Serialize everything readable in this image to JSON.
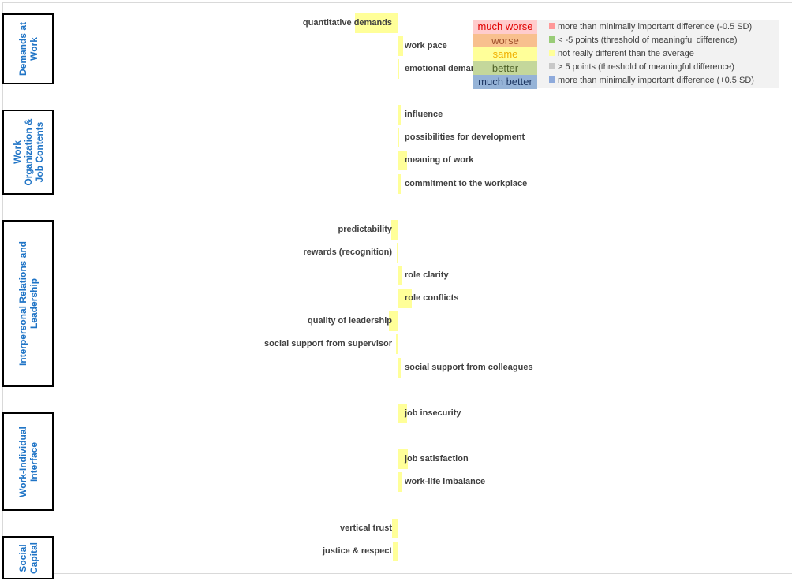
{
  "chart_data": {
    "type": "bar",
    "orientation": "horizontal-diverging",
    "groups": [
      {
        "name": "Demands at\nWork",
        "items": [
          "quantitative demands",
          "work pace",
          "emotional demands"
        ]
      },
      {
        "name": "Work\nOrganization &\nJob Contents",
        "items": [
          "influence",
          "possibilities for development",
          "meaning of work",
          "commitment to the workplace"
        ]
      },
      {
        "name": "Interpersonal Relations and\nLeadership",
        "items": [
          "predictability",
          "rewards (recognition)",
          "role clarity",
          "role conflicts",
          "quality of leadership",
          "social support from supervisor",
          "social support from colleagues"
        ]
      },
      {
        "name": "Work-Individual\nInterface",
        "items": [
          "job insecurity",
          "job satisfaction",
          "work-life imbalance"
        ]
      },
      {
        "name": "Social\nCapital",
        "items": [
          "vertical trust",
          "justice & respect"
        ]
      }
    ],
    "categories": [
      "quantitative demands",
      "work pace",
      "emotional demands",
      "influence",
      "possibilities for development",
      "meaning of work",
      "commitment to the workplace",
      "predictability",
      "rewards (recognition)",
      "role clarity",
      "role conflicts",
      "quality of leadership",
      "social support from supervisor",
      "social support from colleagues",
      "job insecurity",
      "job satisfaction",
      "work-life imbalance",
      "vertical trust",
      "justice & respect"
    ],
    "values": [
      -4.5,
      0.6,
      0.1,
      0.3,
      0.05,
      1.0,
      0.3,
      -0.7,
      -0.1,
      0.4,
      1.5,
      -0.9,
      -0.2,
      0.3,
      1.0,
      1.1,
      0.4,
      -0.6,
      -0.5
    ],
    "classification": [
      "same",
      "same",
      "same",
      "same",
      "same",
      "same",
      "same",
      "same",
      "same",
      "same",
      "same",
      "same",
      "same",
      "same",
      "same",
      "same",
      "same",
      "same",
      "same"
    ],
    "axis_shown": false,
    "grid": false,
    "legend_placement": "top-right",
    "legend": {
      "categories": [
        {
          "label": "much worse",
          "bg": "#ffcccc",
          "fg": "#e00000"
        },
        {
          "label": "worse",
          "bg": "#f8c08e",
          "fg": "#a0522d"
        },
        {
          "label": "same",
          "bg": "#ffff99",
          "fg": "#f0b000"
        },
        {
          "label": "better",
          "bg": "#c4d79b",
          "fg": "#4f6228"
        },
        {
          "label": "much better",
          "bg": "#95b3d7",
          "fg": "#1f3864"
        }
      ],
      "descriptions": [
        {
          "text": "more than minimally important difference (-0.5 SD)",
          "color": "#ff9999"
        },
        {
          "text": "< -5 points (threshold of meaningful difference)",
          "color": "#99cc77"
        },
        {
          "text": "not really different than the average",
          "color": "#ffff99"
        },
        {
          "text": "> 5 points (threshold of meaningful difference)",
          "color": "#c8c8c8"
        },
        {
          "text": "more than minimally important difference (+0.5 SD)",
          "color": "#8eaadb"
        }
      ]
    },
    "colors": {
      "same": "#ffff99",
      "group_label": "#1f74c6"
    }
  }
}
